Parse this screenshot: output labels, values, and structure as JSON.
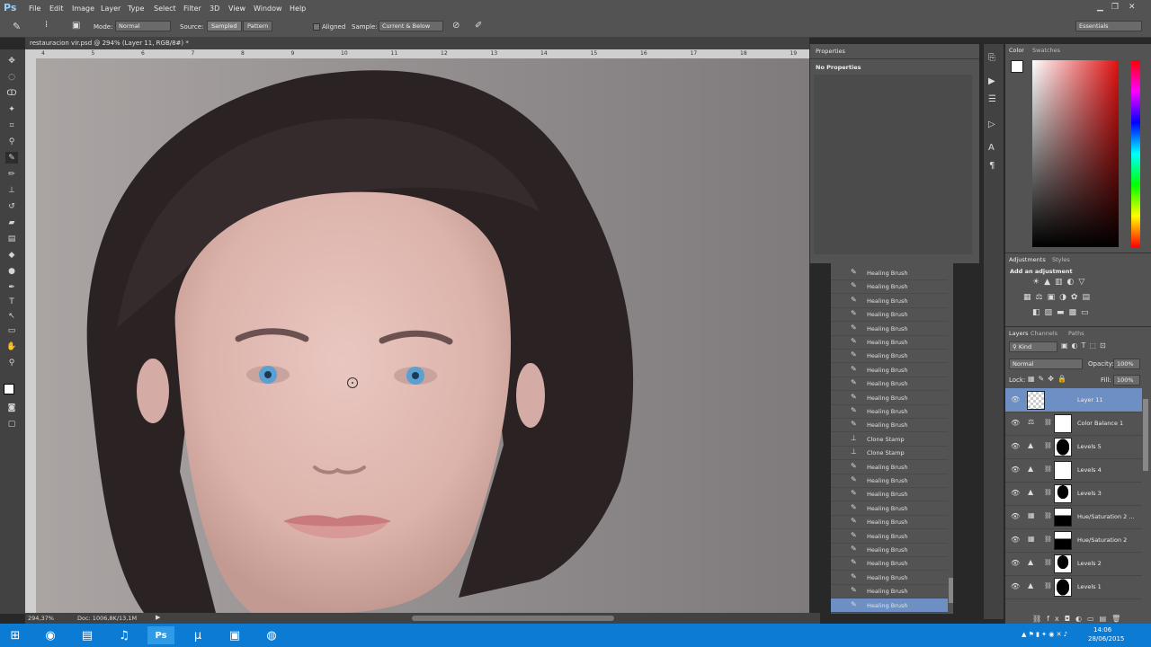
{
  "app": {
    "logo": "Ps"
  },
  "menu": [
    "File",
    "Edit",
    "Image",
    "Layer",
    "Type",
    "Select",
    "Filter",
    "3D",
    "View",
    "Window",
    "Help"
  ],
  "options": {
    "mode_label": "Mode:",
    "mode_value": "Normal",
    "source_label": "Source:",
    "source_sampled": "Sampled",
    "source_pattern": "Pattern",
    "aligned_label": "Aligned",
    "sample_label": "Sample:",
    "sample_value": "Current & Below",
    "workspace": "Essentials"
  },
  "document": {
    "tab_title": "restauracion vir.psd @ 294% (Layer 11, RGB/8#) *",
    "zoom": "294,37%",
    "doc_info": "Doc: 1006,8K/13,1M"
  },
  "ruler": [
    "4",
    "5",
    "6",
    "7",
    "8",
    "9",
    "10",
    "11",
    "12",
    "13",
    "14",
    "15",
    "16",
    "17",
    "18",
    "19"
  ],
  "properties": {
    "tab": "Properties",
    "empty": "No Properties"
  },
  "history": {
    "items": [
      {
        "label": "Healing Brush",
        "icon": "brush-icon"
      },
      {
        "label": "Healing Brush",
        "icon": "brush-icon"
      },
      {
        "label": "Healing Brush",
        "icon": "brush-icon"
      },
      {
        "label": "Healing Brush",
        "icon": "brush-icon"
      },
      {
        "label": "Healing Brush",
        "icon": "brush-icon"
      },
      {
        "label": "Healing Brush",
        "icon": "brush-icon"
      },
      {
        "label": "Healing Brush",
        "icon": "brush-icon"
      },
      {
        "label": "Healing Brush",
        "icon": "brush-icon"
      },
      {
        "label": "Healing Brush",
        "icon": "brush-icon"
      },
      {
        "label": "Healing Brush",
        "icon": "brush-icon"
      },
      {
        "label": "Healing Brush",
        "icon": "brush-icon"
      },
      {
        "label": "Healing Brush",
        "icon": "brush-icon"
      },
      {
        "label": "Clone Stamp",
        "icon": "stamp-icon"
      },
      {
        "label": "Clone Stamp",
        "icon": "stamp-icon"
      },
      {
        "label": "Healing Brush",
        "icon": "brush-icon"
      },
      {
        "label": "Healing Brush",
        "icon": "brush-icon"
      },
      {
        "label": "Healing Brush",
        "icon": "brush-icon"
      },
      {
        "label": "Healing Brush",
        "icon": "brush-icon"
      },
      {
        "label": "Healing Brush",
        "icon": "brush-icon"
      },
      {
        "label": "Healing Brush",
        "icon": "brush-icon"
      },
      {
        "label": "Healing Brush",
        "icon": "brush-icon"
      },
      {
        "label": "Healing Brush",
        "icon": "brush-icon"
      },
      {
        "label": "Healing Brush",
        "icon": "brush-icon"
      },
      {
        "label": "Healing Brush",
        "icon": "brush-icon"
      },
      {
        "label": "Healing Brush",
        "icon": "brush-icon"
      }
    ]
  },
  "color_panel": {
    "tab_color": "Color",
    "tab_swatches": "Swatches"
  },
  "adjustments": {
    "tab_adjustments": "Adjustments",
    "tab_styles": "Styles",
    "add": "Add an adjustment"
  },
  "layers_panel": {
    "tab_layers": "Layers",
    "tab_channels": "Channels",
    "tab_paths": "Paths",
    "filter_kind": "Kind",
    "blend_mode": "Normal",
    "opacity_label": "Opacity:",
    "opacity_value": "100%",
    "lock_label": "Lock:",
    "fill_label": "Fill:",
    "fill_value": "100%",
    "layers": [
      {
        "name": "Layer 11",
        "active": true,
        "mask": "checker",
        "adj": ""
      },
      {
        "name": "Color Balance 1",
        "mask": "white",
        "adj": "⚖"
      },
      {
        "name": "Levels 5",
        "mask": "black-oval",
        "adj": "▲"
      },
      {
        "name": "Levels 4",
        "mask": "white",
        "adj": "▲"
      },
      {
        "name": "Levels 3",
        "mask": "black-silhouette",
        "adj": "▲"
      },
      {
        "name": "Hue/Saturation 2 ...",
        "mask": "black-shape",
        "adj": "▦"
      },
      {
        "name": "Hue/Saturation 2",
        "mask": "black-shape",
        "adj": "▦"
      },
      {
        "name": "Levels 2",
        "mask": "black-silhouette",
        "adj": "▲"
      },
      {
        "name": "Levels 1",
        "mask": "black-oval",
        "adj": "▲"
      }
    ]
  },
  "taskbar": {
    "time": "14:06",
    "date": "28/06/2015",
    "apps": [
      "windows-start-icon",
      "chrome-icon",
      "file-explorer-icon",
      "spotify-icon",
      "photoshop-icon",
      "utorrent-icon",
      "network-drive-icon",
      "obs-icon"
    ]
  },
  "colors": {
    "accent": "#6e8fc3",
    "taskbar": "#0b7bd4",
    "ui_bg": "#535353"
  }
}
